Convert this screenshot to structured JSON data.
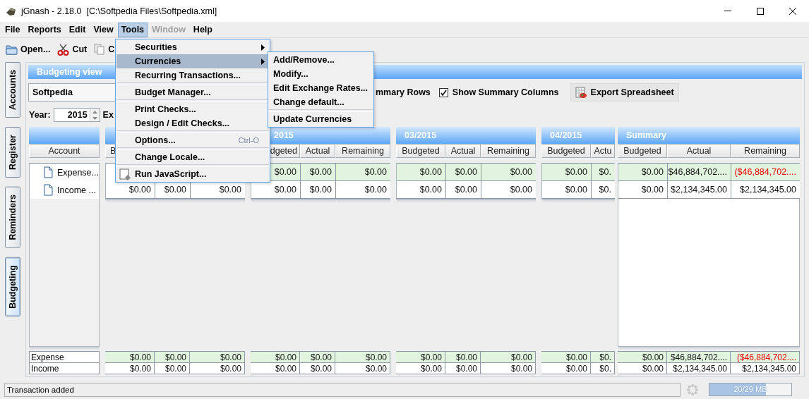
{
  "window": {
    "title": "jGnash - 2.18.0  [C:\\Softpedia Files\\Softpedia.xml]"
  },
  "menu_bar": [
    {
      "label": "File",
      "selected": false,
      "disabled": false
    },
    {
      "label": "Reports",
      "selected": false,
      "disabled": false
    },
    {
      "label": "Edit",
      "selected": false,
      "disabled": false
    },
    {
      "label": "View",
      "selected": false,
      "disabled": false
    },
    {
      "label": "Tools",
      "selected": true,
      "disabled": false
    },
    {
      "label": "Window",
      "selected": false,
      "disabled": true
    },
    {
      "label": "Help",
      "selected": false,
      "disabled": false
    }
  ],
  "toolbar": [
    {
      "kind": "open",
      "label": "Open..."
    },
    {
      "kind": "cut",
      "label": "Cut"
    },
    {
      "kind": "copy",
      "label": "C"
    }
  ],
  "side_tabs": [
    {
      "label": "Accounts",
      "selected": false
    },
    {
      "label": "Register",
      "selected": false
    },
    {
      "label": "Reminders",
      "selected": false
    },
    {
      "label": "Budgeting",
      "selected": true
    }
  ],
  "view": {
    "title": "Budgeting view",
    "budget": "Softpedia",
    "summary_rows_label": "mmary Rows",
    "summary_columns": {
      "label": "Show Summary Columns",
      "checked": true
    },
    "export_button": "Export Spreadsheet",
    "year_label": "Year:",
    "year": "2015",
    "cut_label": "Ex"
  },
  "budget_grid": {
    "account_header": "Account",
    "accounts": [
      {
        "name": "Expense..."
      },
      {
        "name": "Income ..."
      }
    ],
    "row_shaded": [
      true,
      false
    ],
    "totals": [
      {
        "label": "Expense",
        "shaded": true
      },
      {
        "label": "Income",
        "shaded": false
      }
    ],
    "groups": [
      {
        "kind": "month",
        "columns": [
          "B",
          null,
          null
        ],
        "rows": [
          [
            null,
            null,
            null
          ],
          [
            {
              "text": "$0.00",
              "negative": false
            },
            {
              "text": "$0.00",
              "negative": false
            },
            {
              "text": "$0.00",
              "negative": false
            }
          ]
        ],
        "totals": [
          [
            {
              "text": "$0.00",
              "negative": false
            },
            {
              "text": "$0.00",
              "negative": false
            },
            {
              "text": "$0.00",
              "negative": false
            }
          ],
          [
            {
              "text": "$0.00",
              "negative": false
            },
            {
              "text": "$0.00",
              "negative": false
            },
            {
              "text": "$0.00",
              "negative": false
            }
          ]
        ]
      },
      {
        "kind": "month",
        "title": "2015",
        "columns": [
          "dgeted",
          "Actual",
          "Remaining"
        ],
        "rows": [
          [
            {
              "text": "$0.00",
              "negative": false
            },
            {
              "text": "$0.00",
              "negative": false
            },
            {
              "text": "$0.00",
              "negative": false
            }
          ],
          [
            {
              "text": "$0.00",
              "negative": false
            },
            {
              "text": "$0.00",
              "negative": false
            },
            {
              "text": "$0.00",
              "negative": false
            }
          ]
        ],
        "totals": [
          [
            {
              "text": "$0.00",
              "negative": false
            },
            {
              "text": "$0.00",
              "negative": false
            },
            {
              "text": "$0.00",
              "negative": false
            }
          ],
          [
            {
              "text": "$0.00",
              "negative": false
            },
            {
              "text": "$0.00",
              "negative": false
            },
            {
              "text": "$0.00",
              "negative": false
            }
          ]
        ]
      },
      {
        "kind": "month",
        "title": "03/2015",
        "columns": [
          "Budgeted",
          "Actual",
          "Remaining"
        ],
        "rows": [
          [
            {
              "text": "$0.00",
              "negative": false
            },
            {
              "text": "$0.00",
              "negative": false
            },
            {
              "text": "$0.00",
              "negative": false
            }
          ],
          [
            {
              "text": "$0.00",
              "negative": false
            },
            {
              "text": "$0.00",
              "negative": false
            },
            {
              "text": "$0.00",
              "negative": false
            }
          ]
        ],
        "totals": [
          [
            {
              "text": "$0.00",
              "negative": false
            },
            {
              "text": "$0.00",
              "negative": false
            },
            {
              "text": "$0.00",
              "negative": false
            }
          ],
          [
            {
              "text": "$0.00",
              "negative": false
            },
            {
              "text": "$0.00",
              "negative": false
            },
            {
              "text": "$0.00",
              "negative": false
            }
          ]
        ]
      },
      {
        "kind": "month",
        "title": "04/2015",
        "columns": [
          "Budgeted",
          "Actu"
        ],
        "rows": [
          [
            {
              "text": "$0.00",
              "negative": false
            },
            {
              "text": "$0.",
              "negative": false
            }
          ],
          [
            {
              "text": "$0.00",
              "negative": false
            },
            {
              "text": "$0.",
              "negative": false
            }
          ]
        ],
        "totals": [
          [
            {
              "text": "$0.00",
              "negative": false
            },
            {
              "text": "$0.",
              "negative": false
            }
          ],
          [
            {
              "text": "$0.00",
              "negative": false
            },
            {
              "text": "$0.",
              "negative": false
            }
          ]
        ]
      },
      {
        "kind": "summary",
        "title": "Summary",
        "columns": [
          "Budgeted",
          "Actual",
          "Remaining"
        ],
        "rows": [
          [
            {
              "text": "$0.00",
              "negative": false
            },
            {
              "text": "$46,884,702....",
              "negative": false
            },
            {
              "text": "($46,884,702....",
              "negative": true
            }
          ],
          [
            {
              "text": "$0.00",
              "negative": false
            },
            {
              "text": "$2,134,345.00",
              "negative": false
            },
            {
              "text": "$2,134,345.00",
              "negative": false
            }
          ]
        ],
        "totals": [
          [
            {
              "text": "$0.00",
              "negative": false
            },
            {
              "text": "$46,884,702....",
              "negative": false
            },
            {
              "text": "($46,884,702....",
              "negative": true
            }
          ],
          [
            {
              "text": "$0.00",
              "negative": false
            },
            {
              "text": "$2,134,345.00",
              "negative": false
            },
            {
              "text": "$2,134,345.00",
              "negative": false
            }
          ]
        ]
      }
    ]
  },
  "tools_menu": [
    {
      "kind": "item",
      "label": "Securities",
      "selected": false,
      "submenu": true
    },
    {
      "kind": "item",
      "label": "Currencies",
      "selected": true,
      "submenu": true
    },
    {
      "kind": "item",
      "label": "Recurring Transactions...",
      "selected": false,
      "submenu": false
    },
    {
      "kind": "separator"
    },
    {
      "kind": "item",
      "label": "Budget Manager...",
      "selected": false,
      "submenu": false
    },
    {
      "kind": "separator"
    },
    {
      "kind": "item",
      "label": "Print Checks...",
      "selected": false,
      "submenu": false
    },
    {
      "kind": "item",
      "label": "Design / Edit Checks...",
      "selected": false,
      "submenu": false
    },
    {
      "kind": "separator"
    },
    {
      "kind": "item",
      "label": "Options...",
      "selected": false,
      "submenu": false,
      "shortcut": "Ctrl-O"
    },
    {
      "kind": "separator"
    },
    {
      "kind": "item",
      "label": "Change Locale...",
      "selected": false,
      "submenu": false
    },
    {
      "kind": "separator"
    },
    {
      "kind": "icon_item",
      "label": "Run JavaScript...",
      "selected": false,
      "submenu": false
    }
  ],
  "currencies_menu": [
    {
      "kind": "item",
      "label": "Add/Remove..."
    },
    {
      "kind": "item",
      "label": "Modify..."
    },
    {
      "kind": "item",
      "label": "Edit Exchange Rates..."
    },
    {
      "kind": "item",
      "label": "Change default..."
    },
    {
      "kind": "separator"
    },
    {
      "kind": "item",
      "label": "Update Currencies"
    }
  ],
  "status_bar": {
    "message": "Transaction added",
    "memory": {
      "reading": "20/29 MB",
      "level": 0.69
    }
  }
}
